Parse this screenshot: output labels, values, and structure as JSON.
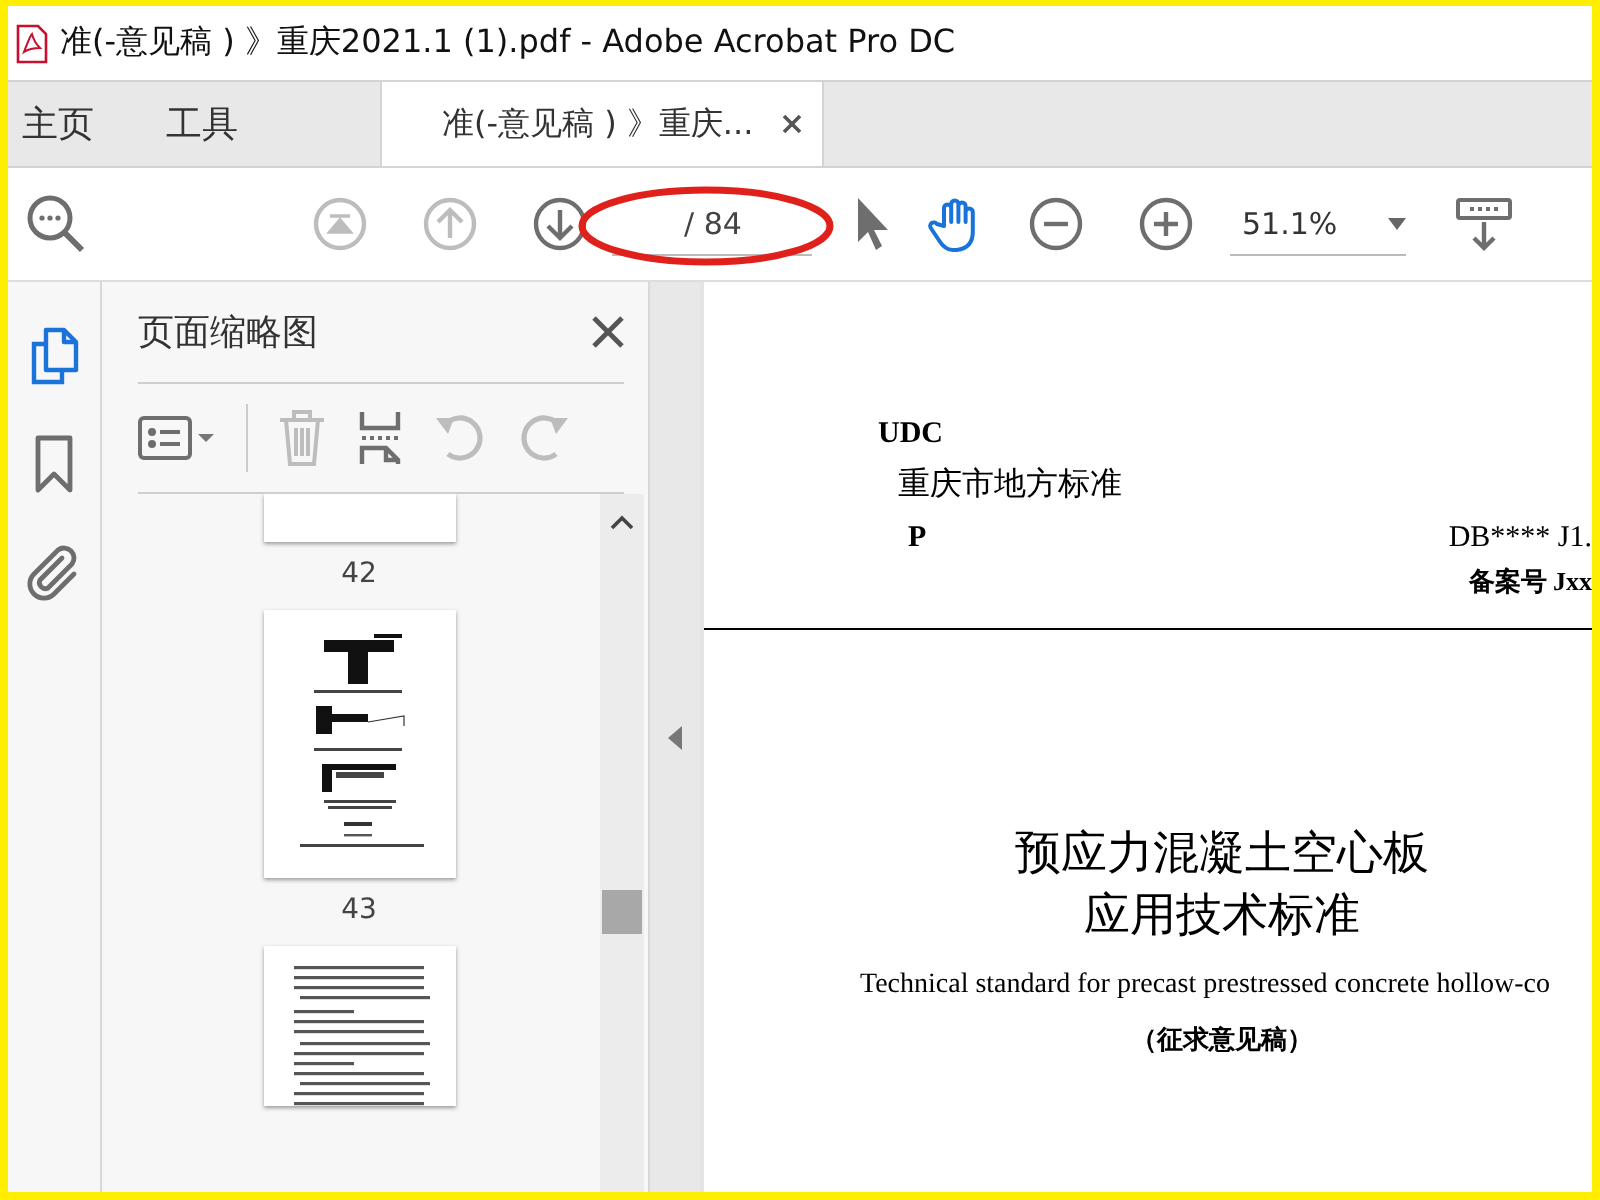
{
  "window": {
    "title": "准(-意见稿 ) 》重庆2021.1 (1).pdf - Adobe Acrobat Pro DC"
  },
  "nav_tabs": [
    {
      "label": "主页",
      "selected": false
    },
    {
      "label": "工具",
      "selected": false
    },
    {
      "label": "准(-意见稿 ) 》重庆...",
      "selected": true
    }
  ],
  "toolbar": {
    "page_total": "/ 84",
    "zoom": "51.1%",
    "tools": [
      {
        "kind": "select",
        "selected": false
      },
      {
        "kind": "hand",
        "selected": true
      }
    ]
  },
  "sidebar_tools": [
    {
      "kind": "pages",
      "selected": true
    },
    {
      "kind": "bookmarks",
      "selected": false
    },
    {
      "kind": "attachments",
      "selected": false
    }
  ],
  "side_panel": {
    "title": "页面缩略图",
    "thumbnails": [
      {
        "kind": "blank",
        "label": "42"
      },
      {
        "kind": "figure",
        "label": "43"
      },
      {
        "kind": "text"
      }
    ]
  },
  "document": {
    "lines": [
      {
        "kind": "code",
        "text": "UDC"
      },
      {
        "kind": "heading",
        "text": "重庆市地方标准"
      },
      {
        "kind": "split",
        "left": "P",
        "right": "DB**** J1."
      },
      {
        "kind": "record",
        "text": "备案号 Jxx"
      },
      {
        "kind": "rule"
      },
      {
        "kind": "title",
        "text": "预应力混凝土空心板"
      },
      {
        "kind": "title",
        "text": "应用技术标准"
      },
      {
        "kind": "subtitle",
        "text": "Technical standard for precast prestressed concrete hollow-co"
      },
      {
        "kind": "note",
        "text": "（征求意见稿）"
      }
    ]
  }
}
